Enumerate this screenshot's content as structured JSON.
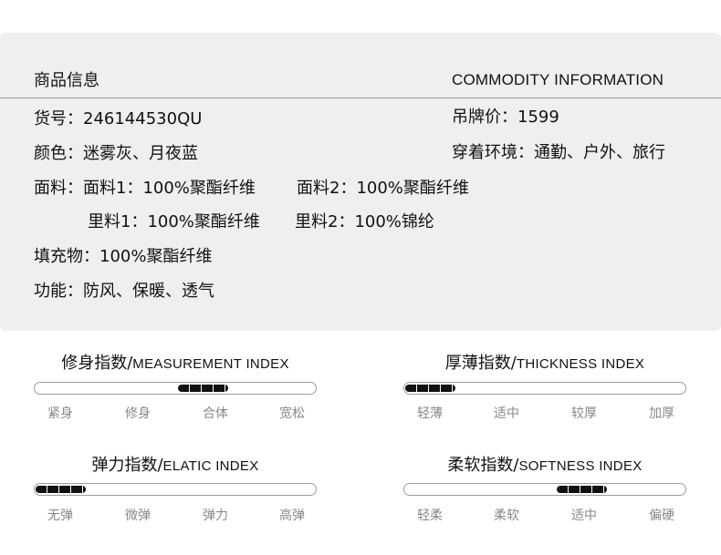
{
  "product_info": {
    "title": "商品信息",
    "title_en": "COMMODITY INFORMATION",
    "item_no": "货号：246144530QU",
    "price": "吊牌价：1599",
    "color": "颜色：迷雾灰、月夜蓝",
    "scene": "穿着环境：通勤、户外、旅行",
    "fabric_1": "面料：面料1：100%聚酯纤维",
    "fabric_2": "面料2：100%聚酯纤维",
    "lining_1": "里料1：100%聚酯纤维",
    "lining_2": "里料2：100%锦纶",
    "filling": "填充物：100%聚酯纤维",
    "function": "功能：防风、保暖、透气"
  },
  "indices": [
    {
      "title": "修身指数/",
      "title_en": "MEASUREMENT INDEX",
      "level": 0.6,
      "labels": [
        "紧身",
        "修身",
        "合体",
        "宽松"
      ]
    },
    {
      "title": "厚薄指数/",
      "title_en": "THICKNESS INDEX",
      "level": 0.08,
      "labels": [
        "轻薄",
        "适中",
        "较厚",
        "加厚"
      ]
    },
    {
      "title": "弹力指数/",
      "title_en": "ELATIC INDEX",
      "level": 0.08,
      "labels": [
        "无弹",
        "微弹",
        "弹力",
        "高弹"
      ]
    },
    {
      "title": "柔软指数/",
      "title_en": "SOFTNESS INDEX",
      "level": 0.63,
      "labels": [
        "轻柔",
        "柔软",
        "适中",
        "偏硬"
      ]
    }
  ]
}
